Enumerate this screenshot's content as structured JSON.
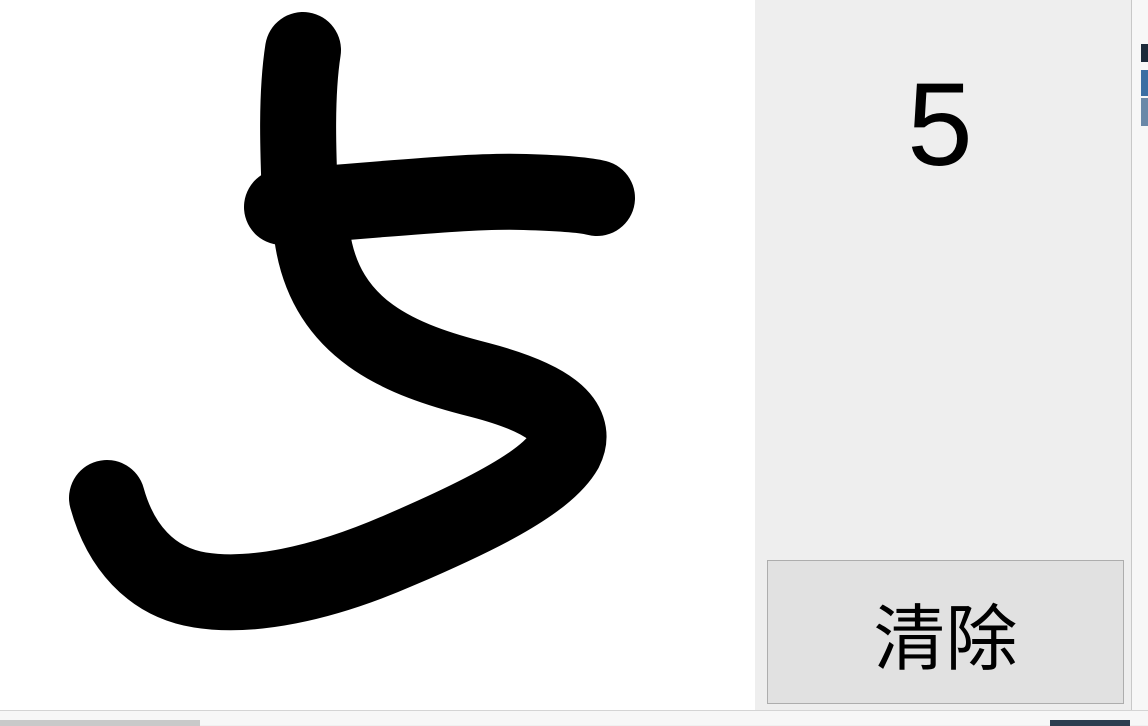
{
  "canvas": {
    "stroke_color": "#000000",
    "background_color": "#ffffff"
  },
  "prediction": {
    "value": "5"
  },
  "clear_button": {
    "label": "清除"
  }
}
